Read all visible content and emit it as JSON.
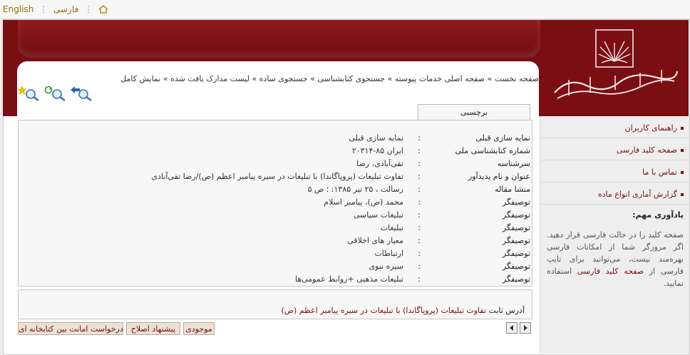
{
  "topbar": {
    "lang_en": "English",
    "lang_fa": "فارسی",
    "home_icon": "home-icon"
  },
  "colors": {
    "brand": "#7b0e13",
    "sidebar_bg": "#eeeeee",
    "panel_bg": "#f7f7f7",
    "button_bg": "#e9e2d6"
  },
  "logo": {
    "text": "سازمان اسناد و کتابخانه ملی جمهوری اسلامی ایران"
  },
  "breadcrumb": {
    "text": "صفحه نخست » صفحه اصلی خدمات پیوسته » جستجوی کتابشناسی » جستجوی ساده » لیست مدارک یافت شده » نمایش کامل"
  },
  "toolbar": {
    "icons": [
      "back-search-icon",
      "refresh-search-icon",
      "new-search-icon"
    ]
  },
  "tab": {
    "label": "برچسبی"
  },
  "record": {
    "rows": [
      {
        "label": "نمایه سازی قبلی",
        "value": "نمایه سازی قبلی"
      },
      {
        "label": "شماره کتابشناسی ملی",
        "value": "ایران ۸۵-۲۰۳۱۴"
      },
      {
        "label": "سرشناسه",
        "value": "تقی‌آبادی، رضا"
      },
      {
        "label": "عنوان و نام پدیدآور",
        "value": "تفاوت تبلیغات (پروپاگاندا) با تبلیغات در سیره پیامبر اعظم (ص)/رضا تقی‌آبادی"
      },
      {
        "label": "منشا مقاله",
        "value": "رسالت ، ۲۵ تیر ۱۳۸۵: ؛ ص ۵"
      },
      {
        "label": "توصیفگر",
        "value": "محمد (ص)، پیامبر اسلام"
      },
      {
        "label": "توصیفگر",
        "value": "تبلیغات سیاسی"
      },
      {
        "label": "توصیفگر",
        "value": "تبلیغات"
      },
      {
        "label": "توصیفگر",
        "value": "معیار های اخلاقی"
      },
      {
        "label": "توصیفگر",
        "value": "ارتباطات"
      },
      {
        "label": "توصیفگر",
        "value": "سیره نبوی"
      },
      {
        "label": "توصیفگر",
        "value": "تبلیغات مذهبی +روابط عمومی‌ها"
      }
    ],
    "colon": ":"
  },
  "address": {
    "label": "آدرس ثابت",
    "value": "تفاوت تبلیغات (پروپاگاندا) با تبلیغات در سیره پیامبر اعظم (ص)"
  },
  "buttons": {
    "availability": "موجودی",
    "suggest_correction": "پیشنهاد اصلاح",
    "interlibrary_loan": "درخواست امانت بین کتابخانه ای"
  },
  "sidebar": {
    "items": [
      {
        "label": "راهنمای کاربران"
      },
      {
        "label": "صفحه کلید فارسی"
      },
      {
        "label": "تماس با ما"
      },
      {
        "label": "گزارش آماری انواع ماده"
      }
    ],
    "notice_title": "یادآوری مهم:",
    "notice_part1": "صفحه کلید را در حالت فارسی قرار دهید. اگر مرورگر شما از امکانات فارسی بهره‌مند نیست، می‌توانید برای تایپ فارسی از",
    "notice_link": "صفحه کلید فارسی",
    "notice_part2": "استفاده نمایید."
  }
}
